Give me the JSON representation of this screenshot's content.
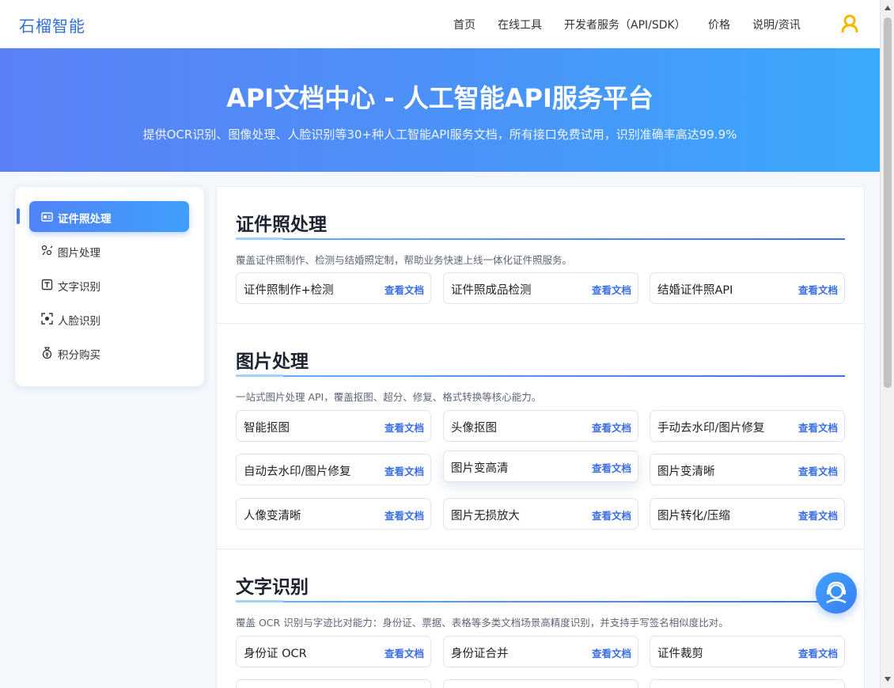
{
  "header": {
    "brand": "石榴智能",
    "nav": [
      "首页",
      "在线工具",
      "开发者服务（API/SDK）",
      "价格",
      "说明/资讯"
    ],
    "user_icon": "user-icon",
    "accent": "#f5b800"
  },
  "hero": {
    "title": "API文档中心 - 人工智能API服务平台",
    "subtitle": "提供OCR识别、图像处理、人脸识别等30+种人工智能API服务文档，所有接口免费试用，识别准确率高达99.9%"
  },
  "sidebar": {
    "items": [
      {
        "label": "证件照处理",
        "icon": "id-card-icon",
        "active": true
      },
      {
        "label": "图片处理",
        "icon": "image-process-icon",
        "active": false
      },
      {
        "label": "文字识别",
        "icon": "text-ocr-icon",
        "active": false
      },
      {
        "label": "人脸识别",
        "icon": "face-scan-icon",
        "active": false
      },
      {
        "label": "积分购买",
        "icon": "money-bag-icon",
        "active": false
      }
    ]
  },
  "sections": [
    {
      "title": "证件照处理",
      "desc": "覆盖证件照制作、检测与结婚照定制，帮助业务快速上线一体化证件照服务。",
      "cards": [
        "证件照制作+检测",
        "证件照成品检测",
        "结婚证件照API"
      ]
    },
    {
      "title": "图片处理",
      "desc": "一站式图片处理 API，覆盖抠图、超分、修复、格式转换等核心能力。",
      "cards": [
        "智能抠图",
        "头像抠图",
        "手动去水印/图片修复",
        "自动去水印/图片修复",
        "图片变高清",
        "图片变清晰",
        "人像变清晰",
        "图片无损放大",
        "图片转化/压缩"
      ]
    },
    {
      "title": "文字识别",
      "desc": "覆盖 OCR 识别与字迹比对能力：身份证、票据、表格等多类文档场景高精度识别，并支持手写签名相似度比对。",
      "cards": [
        "身份证 OCR",
        "身份证合并",
        "证件裁剪"
      ]
    }
  ],
  "card_link_label": "查看文档",
  "fab_icon": "customer-service-icon",
  "colors": {
    "primary": "#3b6fe5",
    "hero_start": "#5b80f5",
    "hero_end": "#3aa9fb"
  }
}
